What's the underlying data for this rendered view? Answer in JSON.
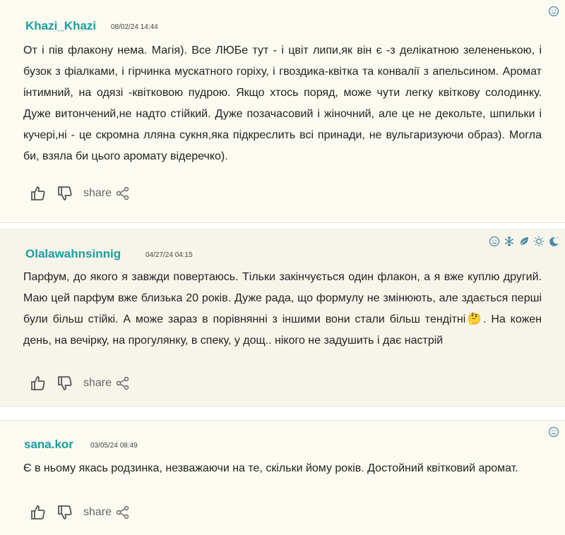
{
  "colors": {
    "accent": "#1a9ea0",
    "icon": "#4a8ca8",
    "bg1": "#fcfbf1",
    "bg2": "#f7f5ea"
  },
  "reviews": [
    {
      "user": "Khazi_Khazi",
      "date": "08/02/24 14:44",
      "text": "От і пів флакону нема. Магія). Все ЛЮБе тут - і цвіт липи,як він є -з делікатною зелененькою, і бузок з фіалками, і гірчинка мускатного горіху, і гвоздика-квітка та конвалії з апельсином. Аромат інтимний, на одязі -квітковою пудрою. Якщо хтось поряд, може чути легку квіткову солодинку. Дуже витончений,не надто стійкий. Дуже позачасовий і жіночний, але це не декольте, шпильки і кучері,ні - це скромна лляна сукня,яка підкреслить всі принади, не вульгаризуючи образ). Могла би, взяла би цього аромату відеречко).",
      "share_label": "share",
      "season_icons": [
        "smile-icon"
      ]
    },
    {
      "user": "Olalawahnsinnig",
      "date": "04/27/24 04:15",
      "text_before": "Парфум, до якого я завжди повертаюсь. Тільки закінчується один флакон, а я вже куплю другий. Маю цей парфум вже близька 20 років. Дуже рада, що формулу не змінюють, але здається перші були більш стійкі. А може зараз в порівнянні з іншими вони стали більш тендітні",
      "emoji": "🤔",
      "text_after": ". На кожен день, на вечірку, на прогулянку, в спеку, у дощ.. нікого не задушить і дає настрій",
      "share_label": "share",
      "season_icons": [
        "smile-icon",
        "snowflake-icon",
        "leaf-icon",
        "sun-icon",
        "moon-icon"
      ]
    },
    {
      "user": "sana.kor",
      "date": "03/05/24 08:49",
      "text": "Є в ньому якась родзинка, незважаючи на те, скільки йому років. Достойний квітковий аромат.",
      "share_label": "share",
      "season_icons": [
        "smile-icon"
      ]
    }
  ]
}
